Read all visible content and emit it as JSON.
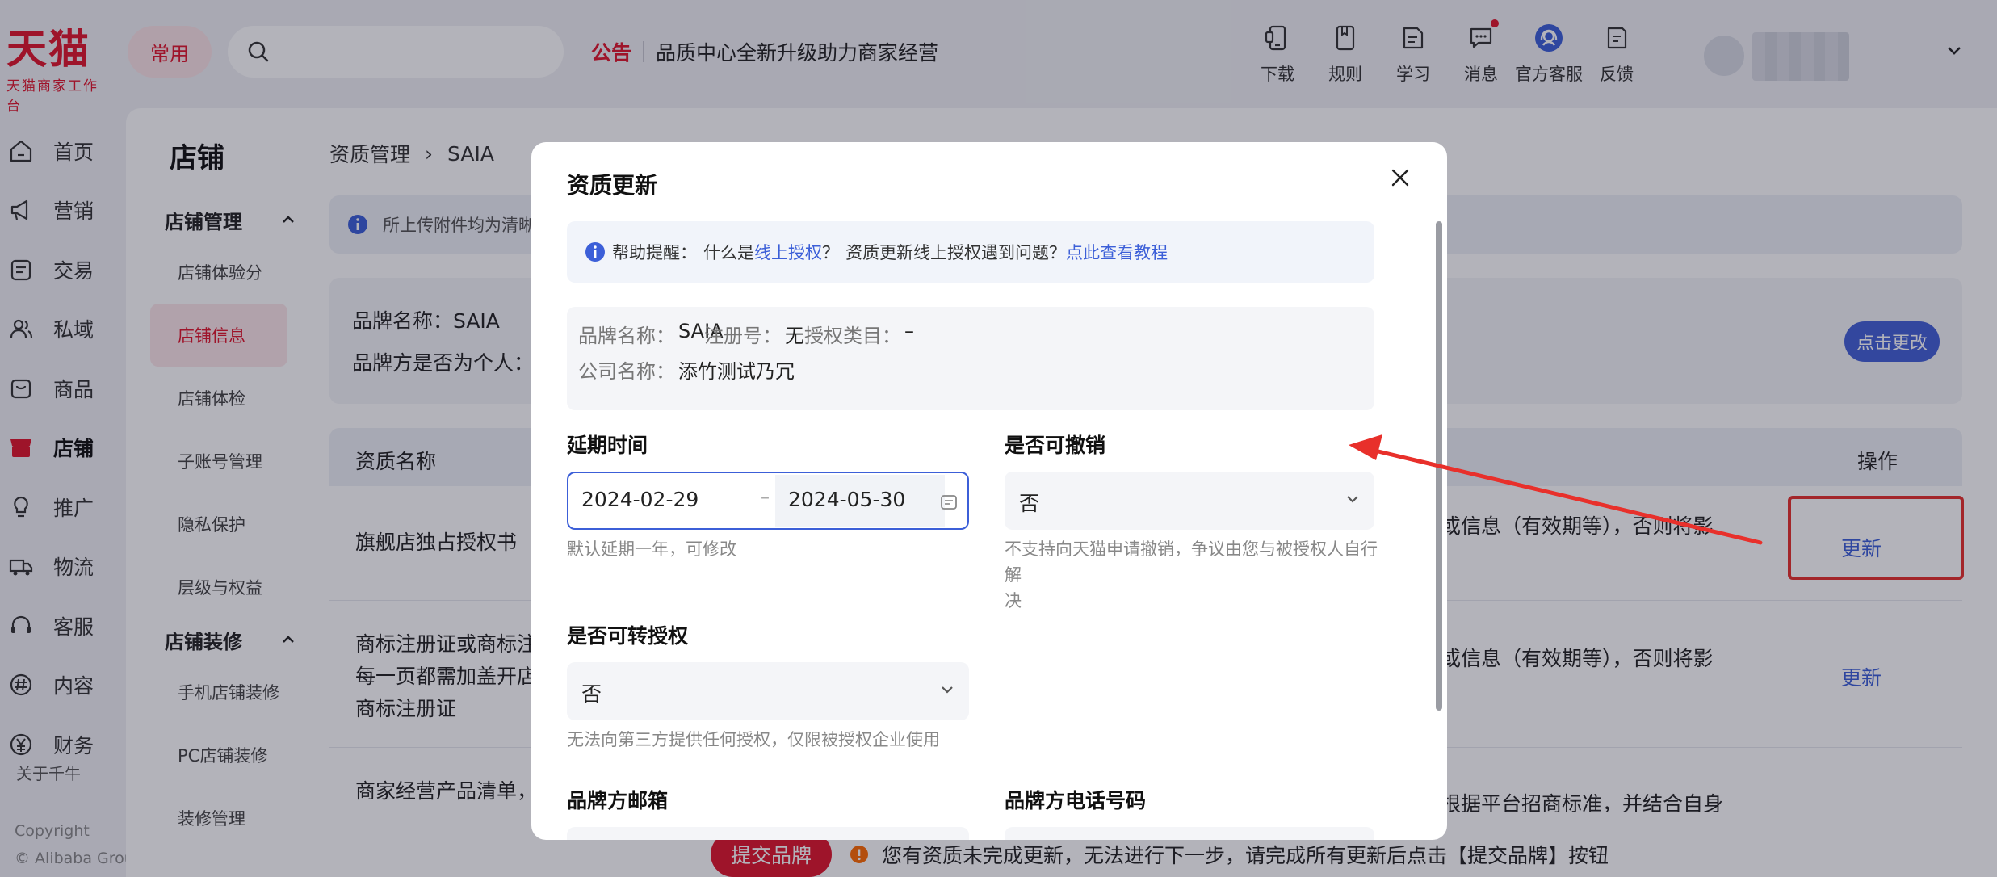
{
  "header": {
    "logo_main": "天猫",
    "logo_sub": "天猫商家工作台",
    "common_label": "常用",
    "notice_tag": "公告",
    "notice_text": "品质中心全新升级助力商家经营",
    "tools": [
      {
        "label": "下载",
        "icon": "phone-download-icon"
      },
      {
        "label": "规则",
        "icon": "rulebook-icon"
      },
      {
        "label": "学习",
        "icon": "study-icon"
      },
      {
        "label": "消息",
        "icon": "message-icon"
      },
      {
        "label": "官方客服",
        "icon": "customer-service-icon"
      },
      {
        "label": "反馈",
        "icon": "feedback-icon"
      }
    ]
  },
  "leftnav": {
    "items": [
      {
        "label": "首页",
        "icon": "home-icon"
      },
      {
        "label": "营销",
        "icon": "megaphone-icon"
      },
      {
        "label": "交易",
        "icon": "transaction-icon"
      },
      {
        "label": "私域",
        "icon": "users-icon"
      },
      {
        "label": "商品",
        "icon": "bag-icon"
      },
      {
        "label": "店铺",
        "icon": "store-icon"
      },
      {
        "label": "推广",
        "icon": "bulb-icon"
      },
      {
        "label": "物流",
        "icon": "truck-icon"
      },
      {
        "label": "客服",
        "icon": "headset-icon"
      },
      {
        "label": "内容",
        "icon": "hash-icon"
      },
      {
        "label": "财务",
        "icon": "yen-icon"
      }
    ],
    "about": "关于千牛",
    "copyright_line1": "Copyright",
    "copyright_line2": "© Alibaba Group"
  },
  "store": {
    "title": "店铺",
    "group1": "店铺管理",
    "group1_items": [
      "店铺体验分",
      "店铺信息",
      "店铺体检",
      "子账号管理",
      "隐私保护",
      "层级与权益"
    ],
    "group2": "店铺装修",
    "group2_items": [
      "手机店铺装修",
      "PC店铺装修",
      "装修管理"
    ]
  },
  "main": {
    "breadcrumb": [
      "资质管理",
      "SAIA"
    ],
    "info_text": "所上传附件均为清晰",
    "brand_name_line": "品牌名称：SAIA",
    "brand_personal_line": "品牌方是否为个人：",
    "change_button": "点击更改",
    "table_head_name": "资质名称",
    "table_head_op": "操作",
    "rows": [
      {
        "name_lines": [
          "旗舰店独占授权书"
        ],
        "desc": "或信息（有效期等），否则将影",
        "op": "更新"
      },
      {
        "name_lines": [
          "商标注册证或商标注",
          "每一页都需加盖开店",
          "商标注册证"
        ],
        "desc": "或信息（有效期等），否则将影",
        "op": "更新"
      },
      {
        "name_lines": [
          "商家经营产品清单，",
          "…"
        ],
        "desc": "根据平台招商标准，并结合自身",
        "op": ""
      }
    ],
    "submit_button": "提交品牌",
    "warning": "您有资质未完成更新，无法进行下一步，请完成所有更新后点击【提交品牌】按钮"
  },
  "modal": {
    "title": "资质更新",
    "help_prefix": "帮助提醒：",
    "help_q1": "什么是",
    "help_link1": "线上授权",
    "help_q1_end": "？",
    "help_q2": "资质更新线上授权遇到问题？",
    "help_link2": "点此查看教程",
    "brand_name_k": "品牌名称：",
    "brand_name_v": "SAIA",
    "reg_no_k": "注册号：",
    "reg_no_v": "无",
    "auth_cat_k": "授权类目：",
    "auth_cat_v": "–",
    "company_k": "公司名称：",
    "company_v": "添竹测试乃冗",
    "extend_label": "延期时间",
    "date_start": "2024-02-29",
    "date_sep": "–",
    "date_end": "2024-05-30",
    "extend_hint": "默认延期一年，可修改",
    "revocable_label": "是否可撤销",
    "revocable_value": "否",
    "revocable_hint_1": "不支持向天猫申请撤销，争议由您与被授权人自行解",
    "revocable_hint_2": "决",
    "transfer_label": "是否可转授权",
    "transfer_value": "否",
    "transfer_hint": "无法向第三方提供任何授权，仅限被授权企业使用",
    "email_label": "品牌方邮箱",
    "phone_label": "品牌方电话号码"
  },
  "colors": {
    "brand_red": "#e0162c",
    "link_blue": "#3c5fd8",
    "annotation_red": "#e8302b"
  }
}
